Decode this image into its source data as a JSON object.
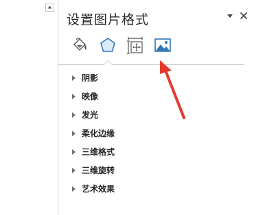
{
  "pane": {
    "title": "设置图片格式",
    "menu_icon": "dropdown-triangle-icon",
    "close_icon": "close-icon",
    "tabs": [
      {
        "id": "fill-line",
        "icon": "paint-bucket-icon",
        "selected": false
      },
      {
        "id": "effects",
        "icon": "pentagon-icon",
        "selected": true
      },
      {
        "id": "size-properties",
        "icon": "size-position-icon",
        "selected": false
      },
      {
        "id": "picture",
        "icon": "picture-icon",
        "selected": false
      }
    ],
    "sections": [
      {
        "label": "阴影"
      },
      {
        "label": "映像"
      },
      {
        "label": "发光"
      },
      {
        "label": "柔化边缘"
      },
      {
        "label": "三维格式"
      },
      {
        "label": "三维旋转"
      },
      {
        "label": "艺术效果"
      }
    ]
  },
  "annotation": {
    "type": "red-arrow",
    "color": "#e23b2e",
    "points_to": "picture-icon"
  },
  "colors": {
    "accent": "#2e75b6",
    "text": "#262626",
    "divider": "#d4d4d4"
  }
}
